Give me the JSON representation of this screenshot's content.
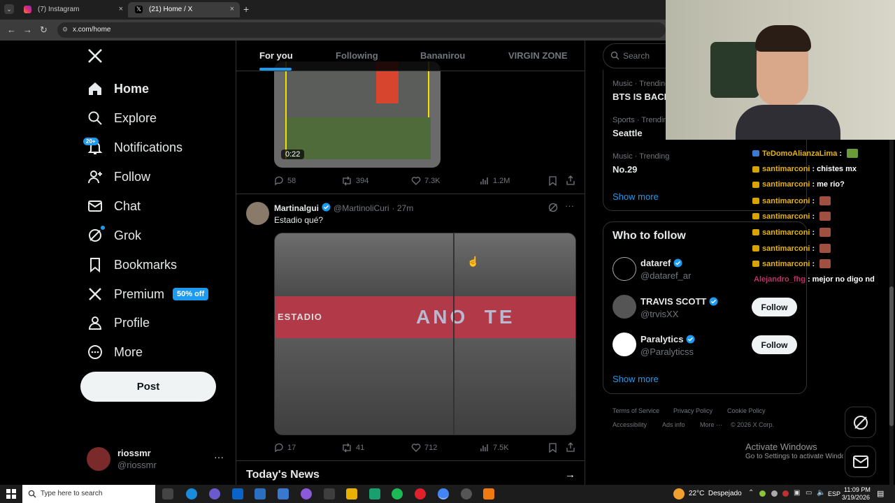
{
  "browser": {
    "tabs": [
      {
        "title": "(7) Instagram"
      },
      {
        "title": "(21) Home / X"
      }
    ],
    "new_tab": "+",
    "close": "×",
    "url": "x.com/home"
  },
  "nav": {
    "items": [
      {
        "label": "Home",
        "icon": "home-icon"
      },
      {
        "label": "Explore",
        "icon": "search-icon"
      },
      {
        "label": "Notifications",
        "icon": "bell-icon",
        "badge": "20+"
      },
      {
        "label": "Follow",
        "icon": "person-plus-icon"
      },
      {
        "label": "Chat",
        "icon": "mail-icon"
      },
      {
        "label": "Grok",
        "icon": "grok-icon"
      },
      {
        "label": "Bookmarks",
        "icon": "bookmark-icon"
      },
      {
        "label": "Premium",
        "icon": "x-logo-icon",
        "badge": "50% off"
      },
      {
        "label": "Profile",
        "icon": "person-icon"
      },
      {
        "label": "More",
        "icon": "more-circle-icon"
      }
    ],
    "post_label": "Post",
    "account": {
      "name": "riossmr",
      "handle": "@riossmr"
    }
  },
  "feed": {
    "tabs": [
      "For you",
      "Following",
      "Bananirou",
      "VIRGIN ZONE"
    ],
    "post1": {
      "video_duration": "0:22",
      "replies": "58",
      "reposts": "394",
      "likes": "7.3K",
      "views": "1.2M"
    },
    "post2": {
      "author": "Martinalgui",
      "handle": "@MartinoliCuri",
      "time": "· 27m",
      "text": "Estadio qué?",
      "image_text_left": "ESTADIO",
      "image_text_right": "ANO  TE",
      "replies": "17",
      "reposts": "41",
      "likes": "712",
      "views": "7.5K"
    },
    "todays_news": "Today's News"
  },
  "right": {
    "search_placeholder": "Search",
    "trends": [
      {
        "category": "Music · Trending",
        "name": "BTS IS BACK"
      },
      {
        "category": "Sports · Trending",
        "name": "Seattle"
      },
      {
        "category": "Music · Trending",
        "name": "No.29"
      }
    ],
    "show_more": "Show more",
    "who_to_follow_title": "Who to follow",
    "who_to_follow": [
      {
        "name": "dataref",
        "handle": "@dataref_ar",
        "button": "Follow"
      },
      {
        "name": "TRAVIS SCOTT",
        "handle": "@trvisXX",
        "button": "Follow"
      },
      {
        "name": "Paralytics",
        "handle": "@Paralyticss",
        "button": "Follow"
      }
    ],
    "show_more_2": "Show more",
    "footer": {
      "terms": "Terms of Service",
      "privacy": "Privacy Policy",
      "cookie": "Cookie Policy",
      "accessibility": "Accessibility",
      "ads": "Ads info",
      "more": "More ···",
      "copyright": "© 2026 X Corp."
    }
  },
  "chat": {
    "lines": [
      {
        "user": "TeDomoAlianzaLima",
        "msg": ""
      },
      {
        "user": "santimarconi",
        "msg": "chistes mx"
      },
      {
        "user": "santimarconi",
        "msg": "me rio?"
      },
      {
        "user": "santimarconi",
        "msg": ""
      },
      {
        "user": "santimarconi",
        "msg": ""
      },
      {
        "user": "santimarconi",
        "msg": ""
      },
      {
        "user": "santimarconi",
        "msg": ""
      },
      {
        "user": "santimarconi",
        "msg": ""
      },
      {
        "user": "Alejandro_fhg",
        "msg": "mejor no digo nd"
      }
    ]
  },
  "activate": {
    "title": "Activate Windows",
    "subtitle": "Go to Settings to activate Windows."
  },
  "taskbar": {
    "search_placeholder": "Type here to search",
    "weather": "22°C  Despejado",
    "lang": "ESP",
    "time": "11:09 PM",
    "date": "3/19/2026"
  }
}
